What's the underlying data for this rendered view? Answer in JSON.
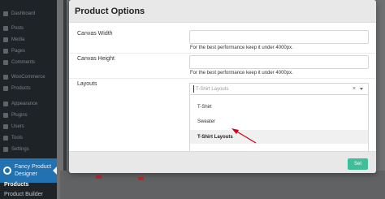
{
  "sidebar": {
    "items": [
      {
        "label": "Dashboard",
        "icon": "dashboard-icon"
      },
      {
        "label": "Posts",
        "icon": "pin-icon"
      },
      {
        "label": "Media",
        "icon": "media-icon"
      },
      {
        "label": "Pages",
        "icon": "page-icon"
      },
      {
        "label": "Comments",
        "icon": "comment-icon"
      },
      {
        "label": "WooCommerce",
        "icon": "woo-icon"
      },
      {
        "label": "Products",
        "icon": "product-icon"
      },
      {
        "label": "Appearance",
        "icon": "brush-icon"
      },
      {
        "label": "Plugins",
        "icon": "plugin-icon"
      },
      {
        "label": "Users",
        "icon": "user-icon"
      },
      {
        "label": "Tools",
        "icon": "wrench-icon"
      },
      {
        "label": "Settings",
        "icon": "settings-icon"
      }
    ],
    "active": {
      "label_line1": "Fancy Product",
      "label_line2": "Designer",
      "icon": "fancy-product-designer-icon"
    },
    "sub_items": [
      {
        "label": "Products"
      },
      {
        "label": "Product Builder"
      }
    ]
  },
  "modal": {
    "title": "Product Options",
    "fields": [
      {
        "label": "Canvas Width",
        "value": "",
        "hint": "For the best performance keep it under 4000px."
      },
      {
        "label": "Canvas Height",
        "value": "",
        "hint": "For the best performance keep it under 4000px."
      }
    ],
    "layouts": {
      "label": "Layouts",
      "selected_value": "T-Shirt Layouts",
      "clear_symbol": "×",
      "options": [
        "T-Shirt",
        "Sweater",
        "T-Shirt Layouts"
      ],
      "highlighted_index": 2
    },
    "footer": {
      "set_label": "Set"
    }
  },
  "colors": {
    "accent_button": "#3ebf9b",
    "active_menu": "#2271b1",
    "annotation_arrow": "#d0021b"
  }
}
